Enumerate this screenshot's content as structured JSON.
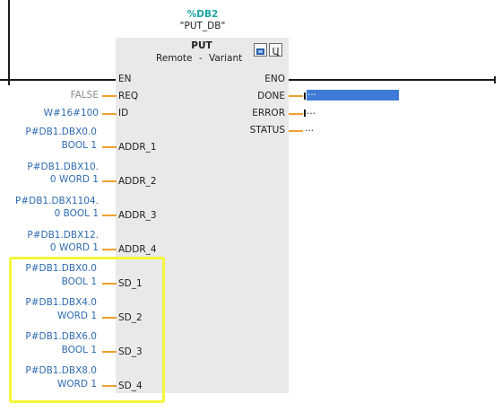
{
  "block": {
    "db_address": "%DB2",
    "db_name": "\"PUT_DB\"",
    "title": "PUT",
    "param_left": "Remote",
    "param_sep": "-",
    "param_right": "Variant"
  },
  "inputs": [
    {
      "pin": "EN",
      "value": ""
    },
    {
      "pin": "REQ",
      "value": "FALSE"
    },
    {
      "pin": "ID",
      "value": "W#16#100"
    },
    {
      "pin": "ADDR_1",
      "value_line1": "P#DB1.DBX0.0",
      "value_line2": "BOOL 1"
    },
    {
      "pin": "ADDR_2",
      "value_line1": "P#DB1.DBX10.",
      "value_line2": "0 WORD 1"
    },
    {
      "pin": "ADDR_3",
      "value_line1": "P#DB1.DBX1104.",
      "value_line2": "0 BOOL 1"
    },
    {
      "pin": "ADDR_4",
      "value_line1": "P#DB1.DBX12.",
      "value_line2": "0 WORD 1"
    },
    {
      "pin": "SD_1",
      "value_line1": "P#DB1.DBX0.0",
      "value_line2": "BOOL 1"
    },
    {
      "pin": "SD_2",
      "value_line1": "P#DB1.DBX4.0",
      "value_line2": "WORD 1"
    },
    {
      "pin": "SD_3",
      "value_line1": "P#DB1.DBX6.0",
      "value_line2": "BOOL 1"
    },
    {
      "pin": "SD_4",
      "value_line1": "P#DB1.DBX8.0",
      "value_line2": "WORD 1"
    }
  ],
  "outputs": [
    {
      "pin": "ENO",
      "value": ""
    },
    {
      "pin": "DONE",
      "value": "..."
    },
    {
      "pin": "ERROR",
      "value": "..."
    },
    {
      "pin": "STATUS",
      "value": "..."
    }
  ],
  "icons": [
    "block-download-icon",
    "block-diagnostics-icon"
  ],
  "colors": {
    "highlight": "#f5f53a",
    "pin_line": "#f0a030",
    "operand_text": "#2e6bb0",
    "block_fill": "#e9e9e9",
    "selection": "#3d7bd6"
  }
}
